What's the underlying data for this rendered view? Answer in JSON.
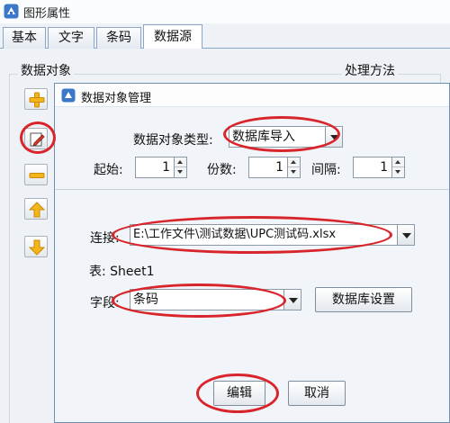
{
  "window": {
    "title": "图形属性"
  },
  "tabs": [
    {
      "label": "基本",
      "active": false
    },
    {
      "label": "文字",
      "active": false
    },
    {
      "label": "条码",
      "active": false
    },
    {
      "label": "数据源",
      "active": true
    }
  ],
  "panel": {
    "data_objects_label": "数据对象",
    "processing_label": "处理方法",
    "side_buttons": [
      "add-icon",
      "edit-icon",
      "remove-icon",
      "move-up-icon",
      "move-down-icon"
    ]
  },
  "dialog": {
    "title": "数据对象管理",
    "type_label": "数据对象类型:",
    "type_value": "数据库导入",
    "start_label": "起始:",
    "start_value": "1",
    "copies_label": "份数:",
    "copies_value": "1",
    "interval_label": "间隔:",
    "interval_value": "1",
    "connection_label": "连接:",
    "connection_value": "E:\\工作文件\\测试数据\\UPC测试码.xlsx",
    "table_text": "表: Sheet1",
    "field_label": "字段:",
    "field_value": "条码",
    "db_settings_button": "数据库设置",
    "edit_button": "编辑",
    "cancel_button": "取消"
  },
  "colors": {
    "annotation_red": "#d8252b",
    "panel_bg": "#eef2f6",
    "border_blue": "#8ea6c2"
  }
}
